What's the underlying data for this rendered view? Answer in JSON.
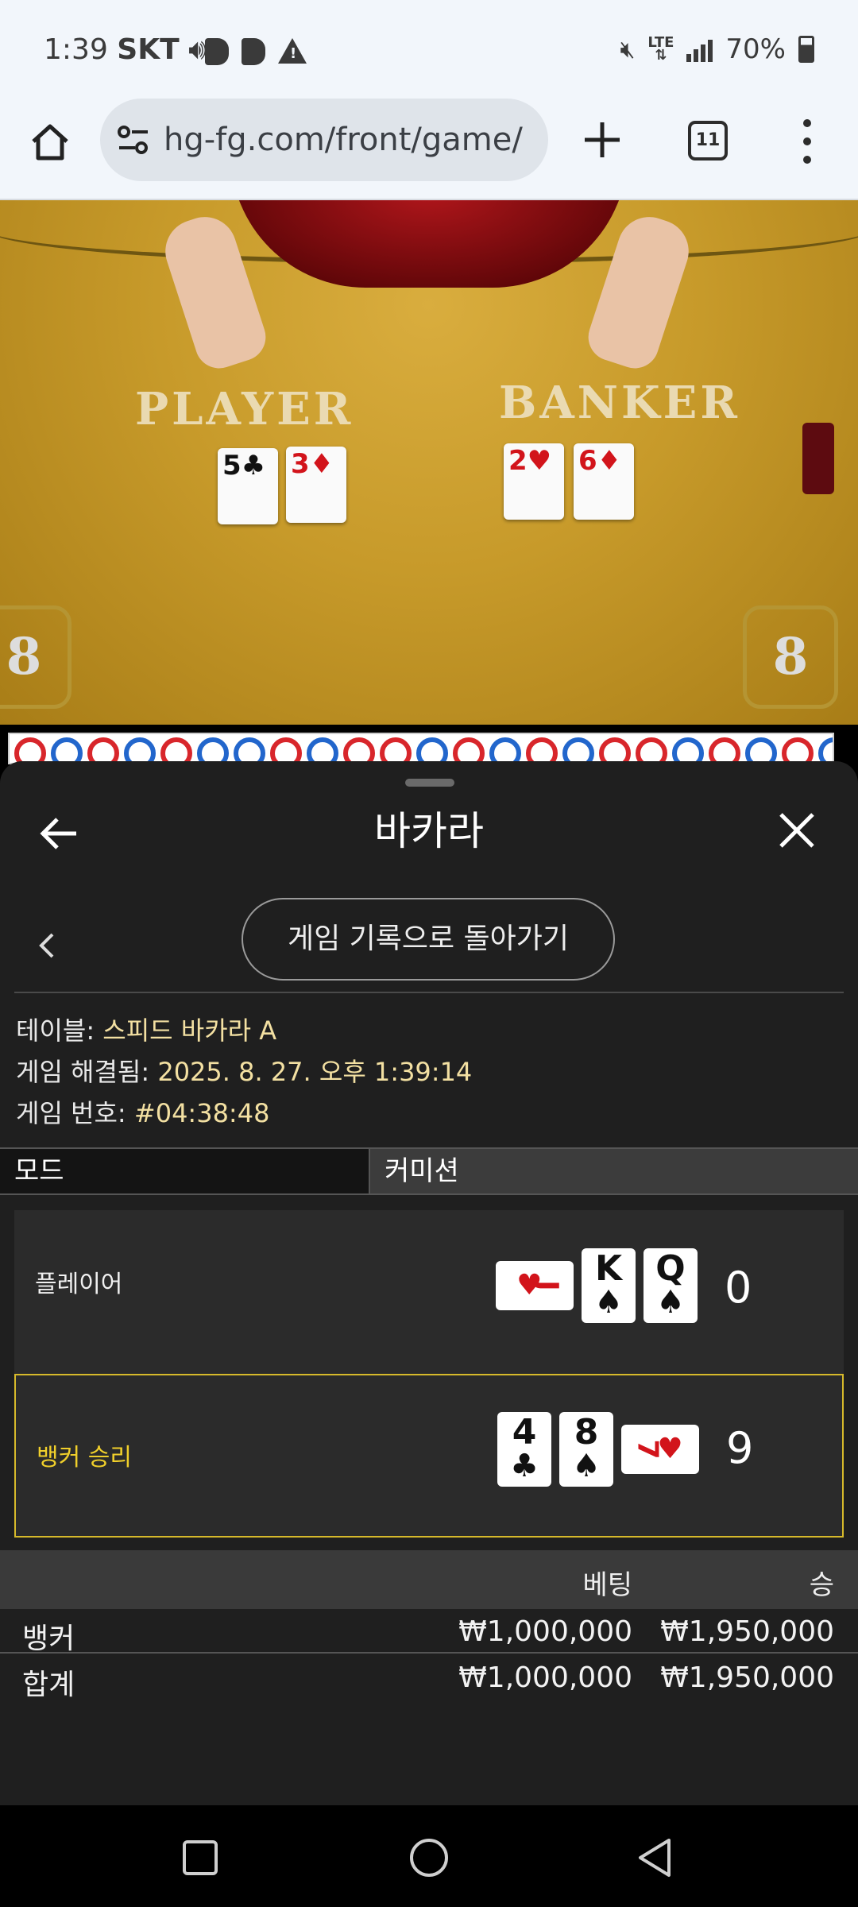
{
  "status_bar": {
    "time": "1:39",
    "carrier": "SKT",
    "battery": "70%",
    "icons": [
      "volume-icon",
      "b-app-icon",
      "b-app-icon",
      "alert-icon",
      "mute-icon",
      "lte-icon",
      "signal-icon",
      "battery-icon"
    ]
  },
  "browser": {
    "url": "hg-fg.com/front/game/",
    "tab_count": "11"
  },
  "game_video": {
    "player_label": "PLAYER",
    "banker_label": "BANKER",
    "player_cards": [
      {
        "rank": "5",
        "suit": "♣"
      },
      {
        "rank": "3",
        "suit": "♦"
      }
    ],
    "banker_cards": [
      {
        "rank": "2",
        "suit": "♥"
      },
      {
        "rank": "6",
        "suit": "♦"
      }
    ],
    "shoe_left": "8",
    "shoe_right": "8"
  },
  "modal": {
    "title": "바카라",
    "back_to_history": "게임 기록으로 돌아가기",
    "table_label": "테이블: ",
    "table_value": "스피드 바카라 A",
    "resolved_label": "게임 해결됨: ",
    "resolved_value": "2025. 8. 27. 오후 1:39:14",
    "game_no_label": "게임 번호: ",
    "game_no_value": "#04:38:48",
    "mode_label": "모드",
    "mode_value": "커미션",
    "player_row": {
      "name": "플레이어",
      "cards": [
        {
          "rank": "J",
          "suit": "♥",
          "color": "red",
          "sideways": true
        },
        {
          "rank": "K",
          "suit": "♠",
          "color": "blk",
          "sideways": false
        },
        {
          "rank": "Q",
          "suit": "♠",
          "color": "blk",
          "sideways": false
        }
      ],
      "score": "0"
    },
    "banker_row": {
      "name": "뱅커 승리",
      "cards": [
        {
          "rank": "4",
          "suit": "♣",
          "color": "blk",
          "sideways": false
        },
        {
          "rank": "8",
          "suit": "♠",
          "color": "blk",
          "sideways": false
        },
        {
          "rank": "7",
          "suit": "♥",
          "color": "red",
          "sideways": true
        }
      ],
      "score": "9"
    },
    "bets": {
      "header_bet": "베팅",
      "header_win": "승",
      "rows": [
        {
          "name": "뱅커",
          "bet": "₩1,000,000",
          "win": "₩1,950,000"
        },
        {
          "name": "합계",
          "bet": "₩1,000,000",
          "win": "₩1,950,000"
        }
      ]
    }
  },
  "colors": {
    "accent_gold": "#d6b92b",
    "road_red": "#d8262b",
    "road_blue": "#2266cc"
  }
}
